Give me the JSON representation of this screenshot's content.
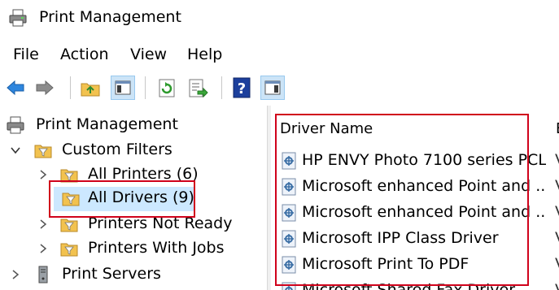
{
  "window": {
    "title": "Print Management"
  },
  "menu": [
    "File",
    "Action",
    "View",
    "Help"
  ],
  "toolbar": {
    "buttons": [
      {
        "icon": "back-arrow-icon"
      },
      {
        "icon": "forward-arrow-icon"
      },
      {
        "icon": "up-folder-icon"
      },
      {
        "icon": "show-hide-console-tree-icon"
      },
      {
        "icon": "refresh-icon"
      },
      {
        "icon": "export-list-icon"
      },
      {
        "icon": "help-icon"
      },
      {
        "icon": "show-hide-action-pane-icon"
      }
    ]
  },
  "tree": {
    "root": "Print Management",
    "custom_filters": "Custom Filters",
    "items": [
      "All Printers (6)",
      "All Drivers (9)",
      "Printers Not Ready",
      "Printers With Jobs"
    ],
    "print_servers": "Print Servers"
  },
  "list": {
    "column_header": "Driver Name",
    "next_column_header": "E",
    "rows": [
      {
        "name": "HP ENVY Photo 7100 series PCL...",
        "cut": "V"
      },
      {
        "name": "Microsoft enhanced Point and ...",
        "cut": "V"
      },
      {
        "name": "Microsoft enhanced Point and ...",
        "cut": "V"
      },
      {
        "name": "Microsoft IPP Class Driver",
        "cut": "V"
      },
      {
        "name": "Microsoft Print To PDF",
        "cut": "V"
      },
      {
        "name": "Microsoft Shared Fax Driver",
        "cut": "V"
      }
    ]
  },
  "colors": {
    "highlight": "#d0021b",
    "selection": "#cce8ff",
    "folder": "#f2c24f",
    "accent": "#1e78d6"
  }
}
